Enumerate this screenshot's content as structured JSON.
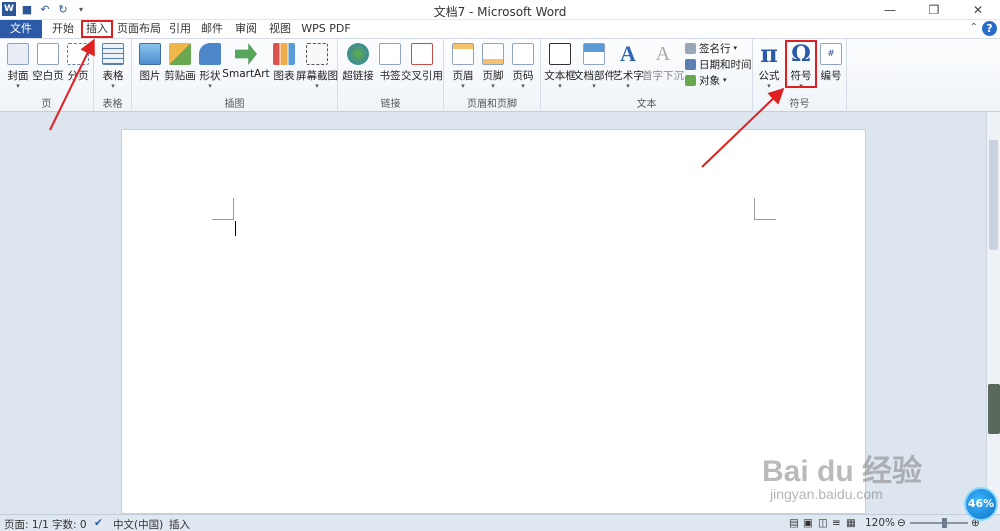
{
  "window": {
    "title": "文档7 - Microsoft Word"
  },
  "tabs": [
    "文件",
    "开始",
    "插入",
    "页面布局",
    "引用",
    "邮件",
    "审阅",
    "视图",
    "WPS PDF"
  ],
  "ribbon": {
    "groups": {
      "pages": {
        "label": "页",
        "buttons": [
          "封面",
          "空白页",
          "分页"
        ]
      },
      "tables": {
        "label": "表格",
        "buttons": [
          "表格"
        ]
      },
      "illustrations": {
        "label": "插图",
        "buttons": [
          "图片",
          "剪贴画",
          "形状",
          "SmartArt",
          "图表",
          "屏幕截图"
        ]
      },
      "links": {
        "label": "链接",
        "buttons": [
          "超链接",
          "书签",
          "交叉引用"
        ]
      },
      "header_footer": {
        "label": "页眉和页脚",
        "buttons": [
          "页眉",
          "页脚",
          "页码"
        ]
      },
      "text": {
        "label": "文本",
        "buttons": [
          "文本框",
          "文档部件",
          "艺术字",
          "首字下沉"
        ],
        "small": [
          "签名行",
          "日期和时间",
          "对象"
        ]
      },
      "symbols": {
        "label": "符号",
        "buttons": [
          "公式",
          "符号",
          "编号"
        ]
      }
    }
  },
  "status": {
    "page": "页面: 1/1",
    "words": "字数: 0",
    "language": "中文(中国)",
    "mode": "插入",
    "zoom": "120%"
  },
  "badge": "46%",
  "watermark": {
    "main": "Bai du 经验",
    "sub": "jingyan.baidu.com"
  },
  "colors": {
    "file_tab": "#2a5aa8",
    "highlight": "#e02020"
  }
}
